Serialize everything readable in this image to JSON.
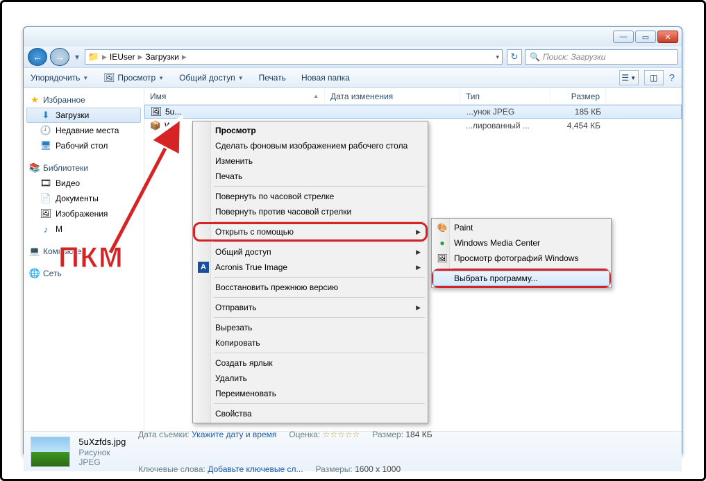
{
  "window": {
    "min": "—",
    "max": "▭",
    "close": "✕"
  },
  "address": {
    "icon": "📁",
    "crumb1": "IEUser",
    "crumb2": "Загрузки",
    "refresh": "↻",
    "search_placeholder": "Поиск: Загрузки"
  },
  "toolbar": {
    "organize": "Упорядочить",
    "preview": "Просмотр",
    "share": "Общий доступ",
    "print": "Печать",
    "newfolder": "Новая папка",
    "help": "?"
  },
  "nav": {
    "favorites": "Избранное",
    "downloads": "Загрузки",
    "recent": "Недавние места",
    "desktop": "Рабочий стол",
    "libraries": "Библиотеки",
    "videos": "Видео",
    "documents": "Документы",
    "pictures": "Изображения",
    "music": "М",
    "computer": "Компьютер",
    "network": "Сеть"
  },
  "columns": {
    "name": "Имя",
    "date": "Дата изменения",
    "type": "Тип",
    "size": "Размер"
  },
  "rows": [
    {
      "name": "5u...",
      "date": "",
      "type": "...унок JPEG",
      "size": "185 КБ",
      "selected": true
    },
    {
      "name": "W...",
      "date": "",
      "type": "...лированный ...",
      "size": "4,454 КБ",
      "selected": false
    }
  ],
  "ctx1": {
    "items": [
      {
        "t": "Просмотр",
        "bold": true
      },
      {
        "t": "Сделать фоновым изображением рабочего стола"
      },
      {
        "t": "Изменить"
      },
      {
        "t": "Печать"
      },
      {
        "sep": true
      },
      {
        "t": "Повернуть по часовой стрелке"
      },
      {
        "t": "Повернуть против часовой стрелки"
      },
      {
        "sep": true
      },
      {
        "t": "Открыть с помощью",
        "sub": true,
        "hl": true
      },
      {
        "sep": true
      },
      {
        "t": "Общий доступ",
        "sub": true
      },
      {
        "t": "Acronis True Image",
        "sub": true,
        "icon": "A"
      },
      {
        "sep": true
      },
      {
        "t": "Восстановить прежнюю версию"
      },
      {
        "sep": true
      },
      {
        "t": "Отправить",
        "sub": true
      },
      {
        "sep": true
      },
      {
        "t": "Вырезать"
      },
      {
        "t": "Копировать"
      },
      {
        "sep": true
      },
      {
        "t": "Создать ярлык"
      },
      {
        "t": "Удалить"
      },
      {
        "t": "Переименовать"
      },
      {
        "sep": true
      },
      {
        "t": "Свойства"
      }
    ]
  },
  "ctx2": {
    "items": [
      {
        "t": "Paint",
        "icon": "🎨"
      },
      {
        "t": "Windows Media Center",
        "icon": "●"
      },
      {
        "t": "Просмотр фотографий Windows",
        "icon": "🖼"
      },
      {
        "sep": true
      },
      {
        "t": "Выбрать программу...",
        "hov": true,
        "hl": true
      }
    ]
  },
  "details": {
    "filename": "5uXzfds.jpg",
    "filetype": "Рисунок JPEG",
    "date_k": "Дата съемки:",
    "date_v": "Укажите дату и время",
    "tags_k": "Ключевые слова:",
    "tags_v": "Добавьте ключевые сл...",
    "rating_k": "Оценка:",
    "rating_v": "☆☆☆☆☆",
    "dims_k": "Размеры:",
    "dims_v": "1600 x 1000",
    "size_k": "Размер:",
    "size_v": "184 КБ"
  },
  "annotation": "ПКМ"
}
